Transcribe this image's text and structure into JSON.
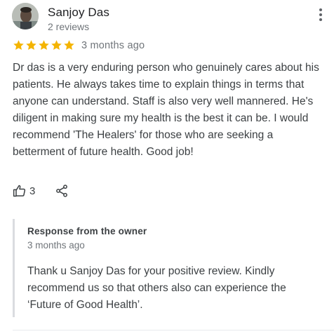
{
  "review": {
    "author": "Sanjoy Das",
    "author_meta": "2 reviews",
    "rating": 5,
    "rating_max": 5,
    "date": "3 months ago",
    "text": "Dr das is a very enduring person who genuinely cares about his patients. He always takes time to explain things in terms that anyone can understand. Staff is also very well mannered. He's diligent in making sure my health is the best it can be. I would recommend 'The Healers' for those who are seeking a betterment of future health. Good job!",
    "likes": "3"
  },
  "owner_response": {
    "title": "Response from the owner",
    "date": "3 months ago",
    "text": "Thank u Sanjoy Das for your positive review. Kindly recommend us so that others also can experience the ‘Future of Good Health’."
  },
  "colors": {
    "star": "#F4B400",
    "text_primary": "#202124",
    "text_secondary": "#70757a",
    "border": "#dadce0"
  },
  "icons": {
    "more": "more-vert-icon",
    "like": "thumbs-up-icon",
    "share": "share-icon",
    "star": "star-icon"
  }
}
